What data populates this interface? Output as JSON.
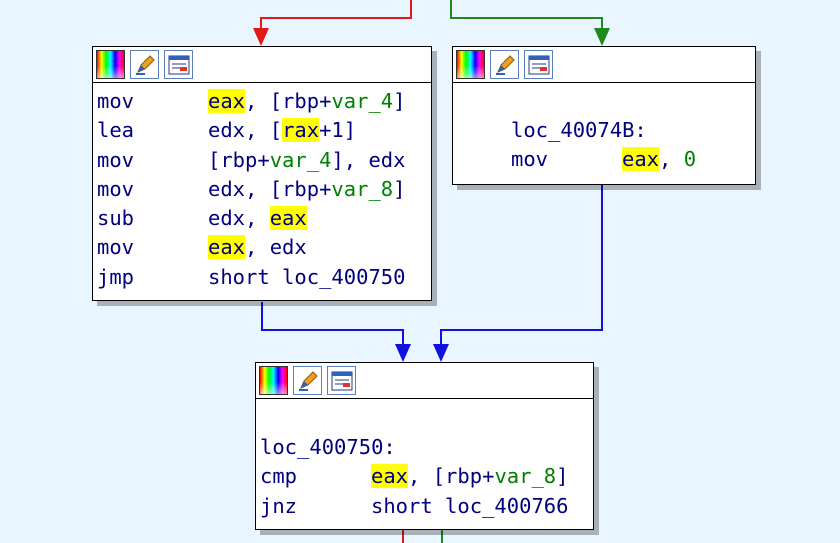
{
  "colors": {
    "false_edge": "#e11818",
    "true_edge": "#1e8a1e",
    "flow_edge": "#1010e0",
    "highlight": "#ffff00",
    "background": "#eaf6ff"
  },
  "header_icons": [
    "color-palette-icon",
    "pencil-icon",
    "graph-icon"
  ],
  "block_left": {
    "lines": [
      {
        "mn": "mov",
        "ops": [
          {
            "t": "eax",
            "hl": true
          },
          {
            "t": ", [rbp+"
          },
          {
            "t": "var_4",
            "var": true
          },
          {
            "t": "]"
          }
        ]
      },
      {
        "mn": "lea",
        "ops": [
          {
            "t": "edx, ["
          },
          {
            "t": "rax",
            "hl": true
          },
          {
            "t": "+1]"
          }
        ]
      },
      {
        "mn": "mov",
        "ops": [
          {
            "t": "[rbp+"
          },
          {
            "t": "var_4",
            "var": true
          },
          {
            "t": "], edx"
          }
        ]
      },
      {
        "mn": "mov",
        "ops": [
          {
            "t": "edx, [rbp+"
          },
          {
            "t": "var_8",
            "var": true
          },
          {
            "t": "]"
          }
        ]
      },
      {
        "mn": "sub",
        "ops": [
          {
            "t": "edx, "
          },
          {
            "t": "eax",
            "hl": true
          }
        ]
      },
      {
        "mn": "mov",
        "ops": [
          {
            "t": "eax",
            "hl": true
          },
          {
            "t": ", edx"
          }
        ]
      },
      {
        "mn": "jmp",
        "ops": [
          {
            "t": "short loc_400750"
          }
        ]
      }
    ]
  },
  "block_right": {
    "label": "loc_40074B:",
    "lines": [
      {
        "mn": "mov",
        "ops": [
          {
            "t": "eax",
            "hl": true
          },
          {
            "t": ", "
          },
          {
            "t": "0",
            "var": true
          }
        ]
      }
    ]
  },
  "block_bottom": {
    "label": "loc_400750:",
    "lines": [
      {
        "mn": "cmp",
        "ops": [
          {
            "t": "eax",
            "hl": true
          },
          {
            "t": ", [rbp+"
          },
          {
            "t": "var_8",
            "var": true
          },
          {
            "t": "]"
          }
        ]
      },
      {
        "mn": "jnz",
        "ops": [
          {
            "t": "short loc_400766"
          }
        ]
      }
    ]
  }
}
